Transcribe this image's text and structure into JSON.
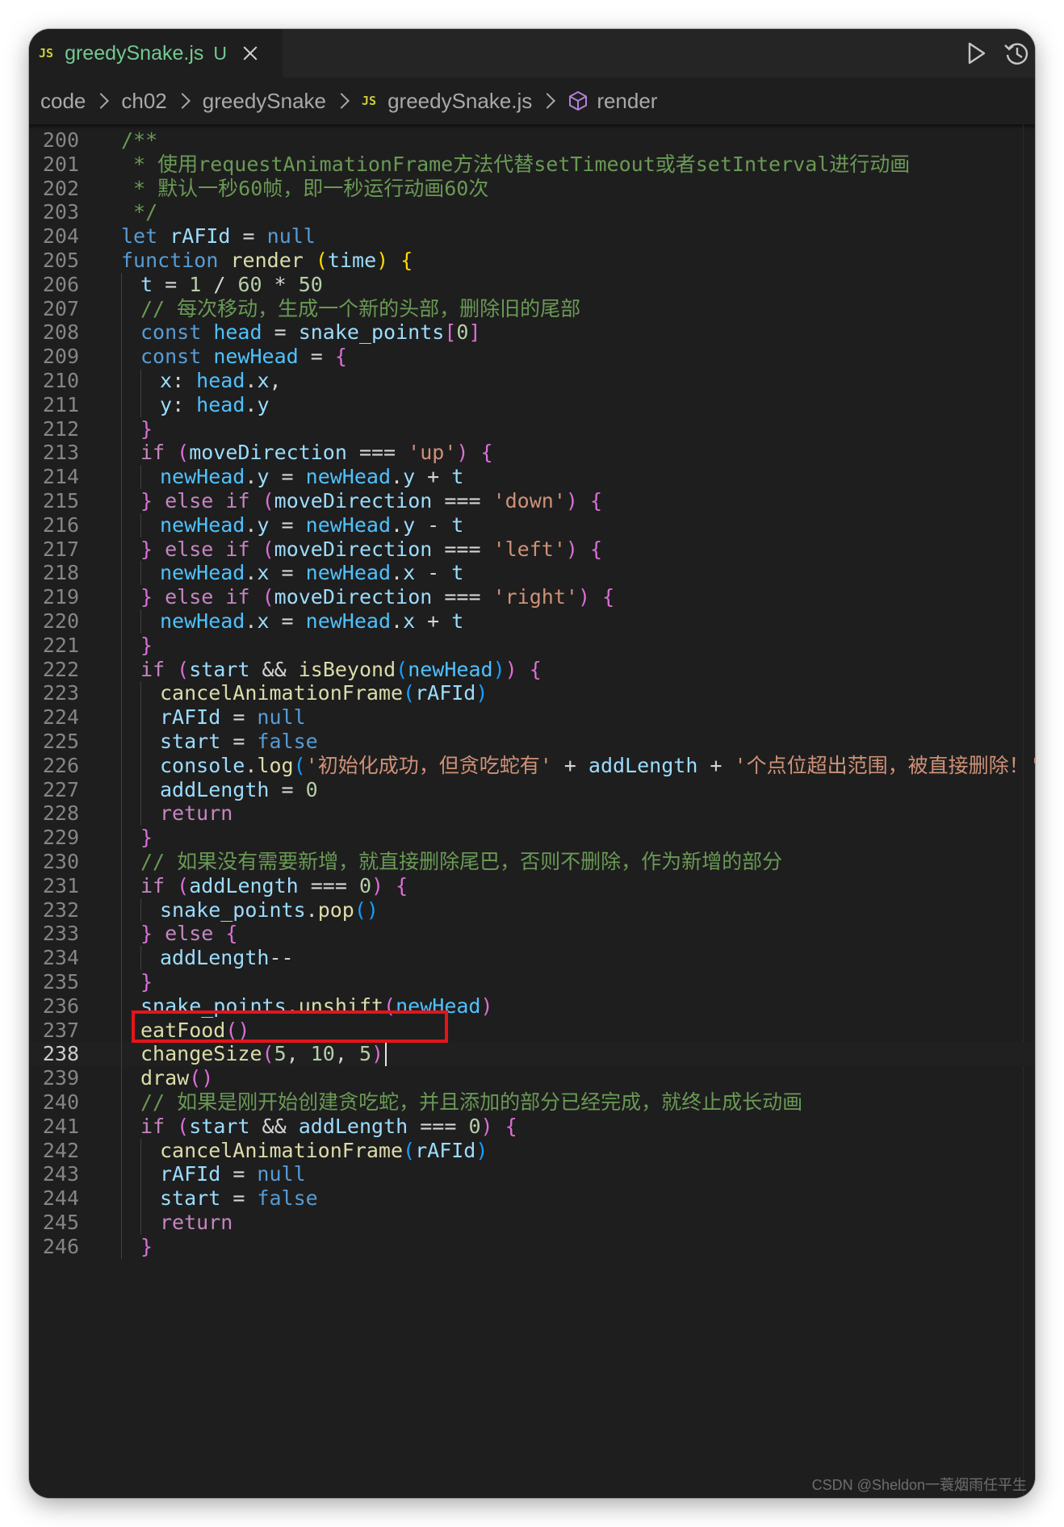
{
  "tab": {
    "file_badge": "JS",
    "title": "greedySnake.js",
    "status": "U"
  },
  "breadcrumb": {
    "items": [
      "code",
      "ch02",
      "greedySnake"
    ],
    "file_badge": "JS",
    "file": "greedySnake.js",
    "symbol": "render"
  },
  "theme": {
    "editor_bg": "#1e1e1e",
    "highlight_box": "#e5141a",
    "modified_file": "#73c991"
  },
  "editor": {
    "current_line": 238,
    "highlighted_line": 238,
    "lines": [
      {
        "n": "200",
        "indent": 0,
        "tokens": [
          [
            "c",
            "/**"
          ]
        ]
      },
      {
        "n": "201",
        "indent": 0,
        "tokens": [
          [
            "c",
            " * 使用requestAnimationFrame方法代替setTimeout或者setInterval进行动画"
          ]
        ]
      },
      {
        "n": "202",
        "indent": 0,
        "tokens": [
          [
            "c",
            " * 默认一秒60帧，即一秒运行动画60次"
          ]
        ]
      },
      {
        "n": "203",
        "indent": 0,
        "tokens": [
          [
            "c",
            " */"
          ]
        ]
      },
      {
        "n": "204",
        "indent": 0,
        "tokens": [
          [
            "k",
            "let"
          ],
          [
            "t",
            " "
          ],
          [
            "v",
            "rAFId"
          ],
          [
            "t",
            " = "
          ],
          [
            "k",
            "null"
          ]
        ]
      },
      {
        "n": "205",
        "indent": 0,
        "tokens": [
          [
            "k",
            "function"
          ],
          [
            "t",
            " "
          ],
          [
            "f",
            "render"
          ],
          [
            "t",
            " "
          ],
          [
            "b1",
            "("
          ],
          [
            "v",
            "time"
          ],
          [
            "b1",
            ")"
          ],
          [
            "t",
            " "
          ],
          [
            "b1",
            "{"
          ]
        ]
      },
      {
        "n": "206",
        "indent": 1,
        "tokens": [
          [
            "v",
            "t"
          ],
          [
            "t",
            " = "
          ],
          [
            "n",
            "1"
          ],
          [
            "t",
            " / "
          ],
          [
            "n",
            "60"
          ],
          [
            "t",
            " * "
          ],
          [
            "n",
            "50"
          ]
        ]
      },
      {
        "n": "207",
        "indent": 1,
        "tokens": [
          [
            "c",
            "// 每次移动，生成一个新的头部，删除旧的尾部"
          ]
        ]
      },
      {
        "n": "208",
        "indent": 1,
        "tokens": [
          [
            "k",
            "const"
          ],
          [
            "t",
            " "
          ],
          [
            "K",
            "head"
          ],
          [
            "t",
            " = "
          ],
          [
            "v",
            "snake_points"
          ],
          [
            "b2",
            "["
          ],
          [
            "n",
            "0"
          ],
          [
            "b2",
            "]"
          ]
        ]
      },
      {
        "n": "209",
        "indent": 1,
        "tokens": [
          [
            "k",
            "const"
          ],
          [
            "t",
            " "
          ],
          [
            "K",
            "newHead"
          ],
          [
            "t",
            " = "
          ],
          [
            "b2",
            "{"
          ]
        ]
      },
      {
        "n": "210",
        "indent": 2,
        "tokens": [
          [
            "v",
            "x"
          ],
          [
            "t",
            ": "
          ],
          [
            "K",
            "head"
          ],
          [
            "t",
            "."
          ],
          [
            "v",
            "x"
          ],
          [
            "t",
            ","
          ]
        ]
      },
      {
        "n": "211",
        "indent": 2,
        "tokens": [
          [
            "v",
            "y"
          ],
          [
            "t",
            ": "
          ],
          [
            "K",
            "head"
          ],
          [
            "t",
            "."
          ],
          [
            "v",
            "y"
          ]
        ]
      },
      {
        "n": "212",
        "indent": 1,
        "tokens": [
          [
            "b2",
            "}"
          ]
        ]
      },
      {
        "n": "213",
        "indent": 1,
        "tokens": [
          [
            "p",
            "if"
          ],
          [
            "t",
            " "
          ],
          [
            "b2",
            "("
          ],
          [
            "v",
            "moveDirection"
          ],
          [
            "t",
            " === "
          ],
          [
            "s",
            "'up'"
          ],
          [
            "b2",
            ")"
          ],
          [
            "t",
            " "
          ],
          [
            "b2",
            "{"
          ]
        ]
      },
      {
        "n": "214",
        "indent": 2,
        "tokens": [
          [
            "K",
            "newHead"
          ],
          [
            "t",
            "."
          ],
          [
            "v",
            "y"
          ],
          [
            "t",
            " = "
          ],
          [
            "K",
            "newHead"
          ],
          [
            "t",
            "."
          ],
          [
            "v",
            "y"
          ],
          [
            "t",
            " + "
          ],
          [
            "v",
            "t"
          ]
        ]
      },
      {
        "n": "215",
        "indent": 1,
        "tokens": [
          [
            "b2",
            "}"
          ],
          [
            "t",
            " "
          ],
          [
            "p",
            "else"
          ],
          [
            "t",
            " "
          ],
          [
            "p",
            "if"
          ],
          [
            "t",
            " "
          ],
          [
            "b2",
            "("
          ],
          [
            "v",
            "moveDirection"
          ],
          [
            "t",
            " === "
          ],
          [
            "s",
            "'down'"
          ],
          [
            "b2",
            ")"
          ],
          [
            "t",
            " "
          ],
          [
            "b2",
            "{"
          ]
        ]
      },
      {
        "n": "216",
        "indent": 2,
        "tokens": [
          [
            "K",
            "newHead"
          ],
          [
            "t",
            "."
          ],
          [
            "v",
            "y"
          ],
          [
            "t",
            " = "
          ],
          [
            "K",
            "newHead"
          ],
          [
            "t",
            "."
          ],
          [
            "v",
            "y"
          ],
          [
            "t",
            " - "
          ],
          [
            "v",
            "t"
          ]
        ]
      },
      {
        "n": "217",
        "indent": 1,
        "tokens": [
          [
            "b2",
            "}"
          ],
          [
            "t",
            " "
          ],
          [
            "p",
            "else"
          ],
          [
            "t",
            " "
          ],
          [
            "p",
            "if"
          ],
          [
            "t",
            " "
          ],
          [
            "b2",
            "("
          ],
          [
            "v",
            "moveDirection"
          ],
          [
            "t",
            " === "
          ],
          [
            "s",
            "'left'"
          ],
          [
            "b2",
            ")"
          ],
          [
            "t",
            " "
          ],
          [
            "b2",
            "{"
          ]
        ]
      },
      {
        "n": "218",
        "indent": 2,
        "tokens": [
          [
            "K",
            "newHead"
          ],
          [
            "t",
            "."
          ],
          [
            "v",
            "x"
          ],
          [
            "t",
            " = "
          ],
          [
            "K",
            "newHead"
          ],
          [
            "t",
            "."
          ],
          [
            "v",
            "x"
          ],
          [
            "t",
            " - "
          ],
          [
            "v",
            "t"
          ]
        ]
      },
      {
        "n": "219",
        "indent": 1,
        "tokens": [
          [
            "b2",
            "}"
          ],
          [
            "t",
            " "
          ],
          [
            "p",
            "else"
          ],
          [
            "t",
            " "
          ],
          [
            "p",
            "if"
          ],
          [
            "t",
            " "
          ],
          [
            "b2",
            "("
          ],
          [
            "v",
            "moveDirection"
          ],
          [
            "t",
            " === "
          ],
          [
            "s",
            "'right'"
          ],
          [
            "b2",
            ")"
          ],
          [
            "t",
            " "
          ],
          [
            "b2",
            "{"
          ]
        ]
      },
      {
        "n": "220",
        "indent": 2,
        "tokens": [
          [
            "K",
            "newHead"
          ],
          [
            "t",
            "."
          ],
          [
            "v",
            "x"
          ],
          [
            "t",
            " = "
          ],
          [
            "K",
            "newHead"
          ],
          [
            "t",
            "."
          ],
          [
            "v",
            "x"
          ],
          [
            "t",
            " + "
          ],
          [
            "v",
            "t"
          ]
        ]
      },
      {
        "n": "221",
        "indent": 1,
        "tokens": [
          [
            "b2",
            "}"
          ]
        ]
      },
      {
        "n": "222",
        "indent": 1,
        "tokens": [
          [
            "p",
            "if"
          ],
          [
            "t",
            " "
          ],
          [
            "b2",
            "("
          ],
          [
            "v",
            "start"
          ],
          [
            "t",
            " && "
          ],
          [
            "f",
            "isBeyond"
          ],
          [
            "b3",
            "("
          ],
          [
            "K",
            "newHead"
          ],
          [
            "b3",
            ")"
          ],
          [
            "b2",
            ")"
          ],
          [
            "t",
            " "
          ],
          [
            "b2",
            "{"
          ]
        ]
      },
      {
        "n": "223",
        "indent": 2,
        "tokens": [
          [
            "f",
            "cancelAnimationFrame"
          ],
          [
            "b3",
            "("
          ],
          [
            "v",
            "rAFId"
          ],
          [
            "b3",
            ")"
          ]
        ]
      },
      {
        "n": "224",
        "indent": 2,
        "tokens": [
          [
            "v",
            "rAFId"
          ],
          [
            "t",
            " = "
          ],
          [
            "k",
            "null"
          ]
        ]
      },
      {
        "n": "225",
        "indent": 2,
        "tokens": [
          [
            "v",
            "start"
          ],
          [
            "t",
            " = "
          ],
          [
            "k",
            "false"
          ]
        ]
      },
      {
        "n": "226",
        "indent": 2,
        "tokens": [
          [
            "v",
            "console"
          ],
          [
            "t",
            "."
          ],
          [
            "f",
            "log"
          ],
          [
            "b3",
            "("
          ],
          [
            "s",
            "'初始化成功，但贪吃蛇有'"
          ],
          [
            "t",
            " + "
          ],
          [
            "v",
            "addLength"
          ],
          [
            "t",
            " + "
          ],
          [
            "s",
            "'个点位超出范围，被直接删除！'"
          ],
          [
            "b3",
            ")"
          ]
        ]
      },
      {
        "n": "227",
        "indent": 2,
        "tokens": [
          [
            "v",
            "addLength"
          ],
          [
            "t",
            " = "
          ],
          [
            "n",
            "0"
          ]
        ]
      },
      {
        "n": "228",
        "indent": 2,
        "tokens": [
          [
            "p",
            "return"
          ]
        ]
      },
      {
        "n": "229",
        "indent": 1,
        "tokens": [
          [
            "b2",
            "}"
          ]
        ]
      },
      {
        "n": "230",
        "indent": 1,
        "tokens": [
          [
            "c",
            "// 如果没有需要新增，就直接删除尾巴，否则不删除，作为新增的部分"
          ]
        ]
      },
      {
        "n": "231",
        "indent": 1,
        "tokens": [
          [
            "p",
            "if"
          ],
          [
            "t",
            " "
          ],
          [
            "b2",
            "("
          ],
          [
            "v",
            "addLength"
          ],
          [
            "t",
            " === "
          ],
          [
            "n",
            "0"
          ],
          [
            "b2",
            ")"
          ],
          [
            "t",
            " "
          ],
          [
            "b2",
            "{"
          ]
        ]
      },
      {
        "n": "232",
        "indent": 2,
        "tokens": [
          [
            "v",
            "snake_points"
          ],
          [
            "t",
            "."
          ],
          [
            "f",
            "pop"
          ],
          [
            "b3",
            "()"
          ]
        ]
      },
      {
        "n": "233",
        "indent": 1,
        "tokens": [
          [
            "b2",
            "}"
          ],
          [
            "t",
            " "
          ],
          [
            "p",
            "else"
          ],
          [
            "t",
            " "
          ],
          [
            "b2",
            "{"
          ]
        ]
      },
      {
        "n": "234",
        "indent": 2,
        "tokens": [
          [
            "v",
            "addLength"
          ],
          [
            "t",
            "--"
          ]
        ]
      },
      {
        "n": "235",
        "indent": 1,
        "tokens": [
          [
            "b2",
            "}"
          ]
        ]
      },
      {
        "n": "236",
        "indent": 1,
        "tokens": [
          [
            "v",
            "snake_points"
          ],
          [
            "t",
            "."
          ],
          [
            "f",
            "unshift"
          ],
          [
            "b2",
            "("
          ],
          [
            "K",
            "newHead"
          ],
          [
            "b2",
            ")"
          ]
        ]
      },
      {
        "n": "237",
        "indent": 1,
        "tokens": [
          [
            "f",
            "eatFood"
          ],
          [
            "b2",
            "()"
          ]
        ]
      },
      {
        "n": "238",
        "indent": 1,
        "tokens": [
          [
            "f",
            "changeSize"
          ],
          [
            "b2",
            "("
          ],
          [
            "n",
            "5"
          ],
          [
            "t",
            ", "
          ],
          [
            "n",
            "10"
          ],
          [
            "t",
            ", "
          ],
          [
            "n",
            "5"
          ],
          [
            "b2",
            ")"
          ]
        ]
      },
      {
        "n": "239",
        "indent": 1,
        "tokens": [
          [
            "f",
            "draw"
          ],
          [
            "b2",
            "()"
          ]
        ]
      },
      {
        "n": "240",
        "indent": 1,
        "tokens": [
          [
            "c",
            "// 如果是刚开始创建贪吃蛇，并且添加的部分已经完成，就终止成长动画"
          ]
        ]
      },
      {
        "n": "241",
        "indent": 1,
        "tokens": [
          [
            "p",
            "if"
          ],
          [
            "t",
            " "
          ],
          [
            "b2",
            "("
          ],
          [
            "v",
            "start"
          ],
          [
            "t",
            " && "
          ],
          [
            "v",
            "addLength"
          ],
          [
            "t",
            " === "
          ],
          [
            "n",
            "0"
          ],
          [
            "b2",
            ")"
          ],
          [
            "t",
            " "
          ],
          [
            "b2",
            "{"
          ]
        ]
      },
      {
        "n": "242",
        "indent": 2,
        "tokens": [
          [
            "f",
            "cancelAnimationFrame"
          ],
          [
            "b3",
            "("
          ],
          [
            "v",
            "rAFId"
          ],
          [
            "b3",
            ")"
          ]
        ]
      },
      {
        "n": "243",
        "indent": 2,
        "tokens": [
          [
            "v",
            "rAFId"
          ],
          [
            "t",
            " = "
          ],
          [
            "k",
            "null"
          ]
        ]
      },
      {
        "n": "244",
        "indent": 2,
        "tokens": [
          [
            "v",
            "start"
          ],
          [
            "t",
            " = "
          ],
          [
            "k",
            "false"
          ]
        ]
      },
      {
        "n": "245",
        "indent": 2,
        "tokens": [
          [
            "p",
            "return"
          ]
        ]
      },
      {
        "n": "246",
        "indent": 1,
        "tokens": [
          [
            "b2",
            "}"
          ]
        ]
      }
    ]
  },
  "watermark": "CSDN @Sheldon一蓑烟雨任平生"
}
